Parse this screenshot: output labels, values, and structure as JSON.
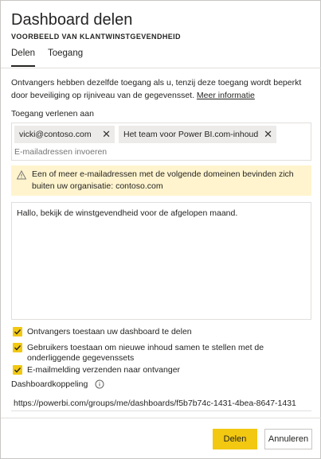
{
  "dialog": {
    "title": "Dashboard delen",
    "subtitle": "VOORBEELD VAN KLANTWINSTGEVENDHEID"
  },
  "tabs": {
    "share": "Delen",
    "access": "Toegang",
    "active": "share"
  },
  "description": {
    "text": "Ontvangers hebben dezelfde toegang als u, tenzij deze toegang wordt beperkt door beveiliging op rijniveau van de gegevensset.",
    "link": "Meer informatie"
  },
  "grant": {
    "label": "Toegang verlenen aan",
    "recipients": [
      "vicki@contoso.com",
      "Het team voor Power BI.com-inhoud"
    ],
    "input_placeholder": "E-mailadressen invoeren"
  },
  "warning": {
    "text": "Een of meer e-mailadressen met de volgende domeinen bevinden zich buiten uw organisatie: contoso.com"
  },
  "message": {
    "value": "Hallo, bekijk de winstgevendheid voor de afgelopen maand."
  },
  "options": {
    "allow_share": "Ontvangers toestaan uw dashboard te delen",
    "allow_build": "Gebruikers toestaan om nieuwe inhoud samen te stellen met de onderliggende gegevenssets",
    "send_email": "E-mailmelding verzenden naar ontvanger"
  },
  "link": {
    "label": "Dashboardkoppeling",
    "value": "https://powerbi.com/groups/me/dashboards/f5b7b74c-1431-4bea-8647-1431"
  },
  "buttons": {
    "share": "Delen",
    "cancel": "Annuleren"
  },
  "colors": {
    "accent": "#f2c811",
    "warning_bg": "#fff4ce"
  }
}
